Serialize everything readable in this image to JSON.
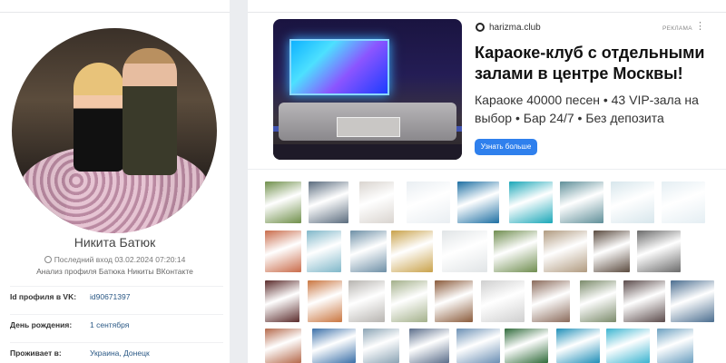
{
  "profile": {
    "name": "Никита Батюк",
    "last_seen": "Последний вход 03.02.2024 07:20:14",
    "analysis": "Анализ профиля Батюка Никиты ВКонтакте",
    "fields": [
      {
        "label": "Id профиля в VK:",
        "value": "id90671397"
      },
      {
        "label": "День рождения:",
        "value": "1 сентября"
      },
      {
        "label": "Проживает в:",
        "value": "Украина, Донецк"
      }
    ]
  },
  "ad": {
    "domain": "harizma.club",
    "label": "РЕКЛАМА",
    "title": "Караоке-клуб с отдельными залами в центре Москвы!",
    "description": "Караоке 40000 песен • 43 VIP-зала на выбор • Бар 24/7 • Без депозита",
    "button": "Узнать больше"
  },
  "photos": {
    "rows": [
      [
        "#6f8f4a",
        "#5a6b7d",
        "#d9d4cf",
        "#e9eef2",
        "#1d6fa3",
        "#1aa7b8",
        "#5f8f99",
        "#d7e6ec",
        "#e4eef3"
      ],
      [
        "#c96b4a",
        "#7fb7c9",
        "#6d8fa6",
        "#c9a24a",
        "#e0e4e6",
        "#6f8d4f",
        "#b09a7f",
        "#5a4a3e",
        "#6a6a6a"
      ],
      [
        "#5a2b2b",
        "#c9753f",
        "#b7b4b0",
        "#a3b08a",
        "#8a5a3a",
        "#cfcfcf",
        "#8a6a5a",
        "#7a8a6a",
        "#5a4a4a",
        "#4a6d8f"
      ],
      [
        "#b4684a",
        "#3a6fa8",
        "#8aa3b4",
        "#5a6d8a",
        "#6a8fb4",
        "#2f6a3a",
        "#1f8fb8",
        "#3ab4d0",
        "#6a9fc0"
      ]
    ]
  }
}
